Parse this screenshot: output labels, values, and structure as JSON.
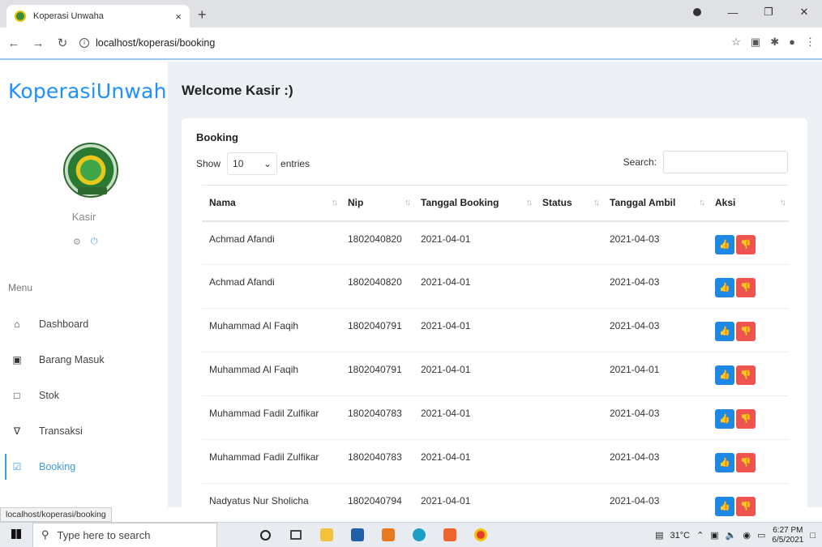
{
  "browser": {
    "tab_title": "Koperasi Unwaha",
    "tab_close": "×",
    "new_tab": "+",
    "url": "localhost/koperasi/booking",
    "status_url": "localhost/koperasi/booking"
  },
  "sidebar": {
    "brand": "KoperasiUnwaha",
    "user": "Kasir",
    "menu_title": "Menu",
    "items": [
      {
        "label": "Dashboard",
        "icon": "home-icon"
      },
      {
        "label": "Barang Masuk",
        "icon": "box-icon"
      },
      {
        "label": "Stok",
        "icon": "clipboard-icon"
      },
      {
        "label": "Transaksi",
        "icon": "cart-icon"
      },
      {
        "label": "Booking",
        "icon": "check-square-icon",
        "active": true
      }
    ]
  },
  "main": {
    "welcome": "Welcome Kasir :)",
    "card_title": "Booking",
    "show_label": "Show",
    "entries_value": "10",
    "entries_label": "entries",
    "search_label": "Search:",
    "search_value": "",
    "columns": [
      "Nama",
      "Nip",
      "Tanggal Booking",
      "Status",
      "Tanggal Ambil",
      "Aksi"
    ],
    "rows": [
      {
        "nama": "Achmad Afandi",
        "nip": "1802040820",
        "tanggal_booking": "2021-04-01",
        "status": "",
        "tanggal_ambil": "2021-04-03"
      },
      {
        "nama": "Achmad Afandi",
        "nip": "1802040820",
        "tanggal_booking": "2021-04-01",
        "status": "",
        "tanggal_ambil": "2021-04-03"
      },
      {
        "nama": "Muhammad Al Faqih",
        "nip": "1802040791",
        "tanggal_booking": "2021-04-01",
        "status": "",
        "tanggal_ambil": "2021-04-03"
      },
      {
        "nama": "Muhammad Al Faqih",
        "nip": "1802040791",
        "tanggal_booking": "2021-04-01",
        "status": "",
        "tanggal_ambil": "2021-04-01"
      },
      {
        "nama": "Muhammad Fadil Zulfikar",
        "nip": "1802040783",
        "tanggal_booking": "2021-04-01",
        "status": "",
        "tanggal_ambil": "2021-04-03"
      },
      {
        "nama": "Muhammad Fadil Zulfikar",
        "nip": "1802040783",
        "tanggal_booking": "2021-04-01",
        "status": "",
        "tanggal_ambil": "2021-04-03"
      },
      {
        "nama": "Nadyatus Nur Sholicha",
        "nip": "1802040794",
        "tanggal_booking": "2021-04-01",
        "status": "",
        "tanggal_ambil": "2021-04-03"
      }
    ]
  },
  "taskbar": {
    "search_placeholder": "Type here to search",
    "temperature": "31°C",
    "time": "6:27 PM",
    "date": "6/5/2021"
  },
  "colors": {
    "accent": "#3b9ae1",
    "brand": "#1e90ff",
    "approve": "#1e88e5",
    "reject": "#ef5350"
  }
}
